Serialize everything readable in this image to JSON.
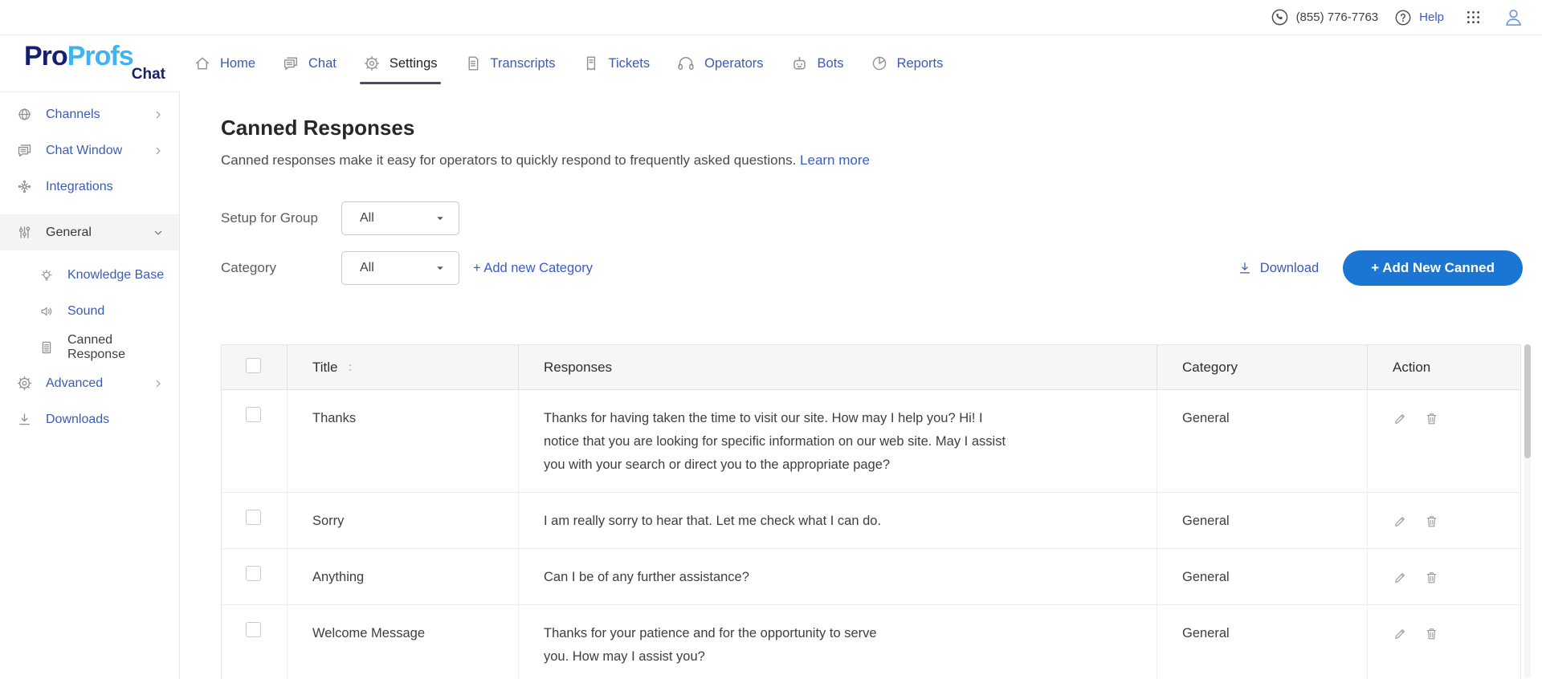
{
  "topbar": {
    "phone_number": "(855) 776-7763",
    "help_label": "Help",
    "icons": [
      "phone-icon",
      "question-icon",
      "apps-grid-icon",
      "user-avatar-icon"
    ]
  },
  "logo": {
    "part1": "Pro",
    "part2": "Profs",
    "part3": "Chat"
  },
  "nav": {
    "items": [
      {
        "label": "Home",
        "icon": "home-icon",
        "active": false
      },
      {
        "label": "Chat",
        "icon": "chat-icon",
        "active": false
      },
      {
        "label": "Settings",
        "icon": "gear-icon",
        "active": true
      },
      {
        "label": "Transcripts",
        "icon": "document-icon",
        "active": false
      },
      {
        "label": "Tickets",
        "icon": "ticket-icon",
        "active": false
      },
      {
        "label": "Operators",
        "icon": "headset-icon",
        "active": false
      },
      {
        "label": "Bots",
        "icon": "robot-icon",
        "active": false
      },
      {
        "label": "Reports",
        "icon": "pie-chart-icon",
        "active": false
      }
    ]
  },
  "sidebar": {
    "items": [
      {
        "label": "Channels",
        "icon": "globe-network-icon",
        "chevron": "right"
      },
      {
        "label": "Chat Window",
        "icon": "chat-window-icon",
        "chevron": "right"
      },
      {
        "label": "Integrations",
        "icon": "hub-icon",
        "chevron": "none"
      },
      {
        "label": "General",
        "icon": "sliders-icon",
        "chevron": "down",
        "active": true
      },
      {
        "label": "Knowledge Base",
        "icon": "lightbulb-icon",
        "sub": true
      },
      {
        "label": "Sound",
        "icon": "speaker-icon",
        "sub": true
      },
      {
        "label": "Canned Response",
        "icon": "document-lines-icon",
        "sub": true,
        "active": true
      },
      {
        "label": "Advanced",
        "icon": "gear-icon",
        "chevron": "right"
      },
      {
        "label": "Downloads",
        "icon": "download-icon",
        "chevron": "none"
      }
    ]
  },
  "page": {
    "title": "Canned Responses",
    "description": "Canned responses make it easy for operators to quickly respond to frequently asked questions.",
    "learn_more_label": "Learn more"
  },
  "filters": {
    "group_label": "Setup for Group",
    "group_value": "All",
    "category_label": "Category",
    "category_value": "All",
    "add_category_label": "+ Add new Category"
  },
  "toolbar": {
    "download_label": "Download",
    "add_new_label": "+ Add New Canned"
  },
  "table": {
    "headers": {
      "title": "Title",
      "responses": "Responses",
      "category": "Category",
      "action": "Action"
    },
    "rows": [
      {
        "title": "Thanks",
        "response": "Thanks for having taken the time to visit our site. How may I help you? Hi! I\nnotice that you are looking for specific information on our web site. May I assist\nyou with your search or direct you to the appropriate page?",
        "category": "General"
      },
      {
        "title": "Sorry",
        "response": "I am really sorry to hear that. Let me check what I can do.",
        "category": "General"
      },
      {
        "title": "Anything",
        "response": "Can I be of any further assistance?",
        "category": "General"
      },
      {
        "title": "Welcome Message",
        "response": "Thanks for your patience and for the opportunity to serve\nyou. How may I assist you?",
        "category": "General"
      }
    ]
  },
  "colors": {
    "accent_link_blue": "#3a5dc4",
    "nav_blue": "#3b5bb5",
    "button_blue": "#1b76d3",
    "logo_navy": "#151f6e",
    "logo_light_blue": "#41b2f0"
  }
}
